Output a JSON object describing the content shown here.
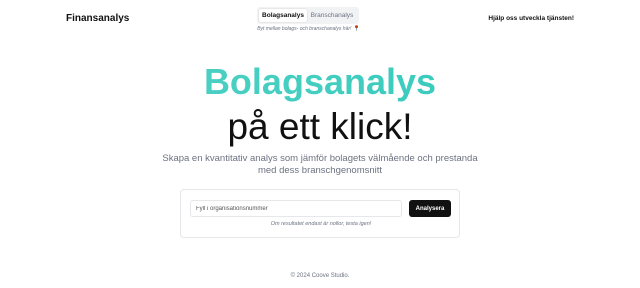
{
  "header": {
    "brand": "Finansanalys",
    "help_link": "Hjälp oss utveckla tjänsten!",
    "toggle": {
      "options": [
        "Bolagsanalys",
        "Branschanalys"
      ],
      "selected": "Bolagsanalys",
      "hint": "Byt mellan bolags- och branschanalys här!",
      "hint_icon": "pin-icon"
    }
  },
  "hero": {
    "title_accent": "Bolagsanalys",
    "title_main": "på ett klick!",
    "subtitle": "Skapa en kvantitativ analys som jämför bolagets välmående och prestanda med dess branschgenomsnitt"
  },
  "form": {
    "input_placeholder": "Fyll i organisationsnummer",
    "input_value": "",
    "button_label": "Analysera",
    "note": "Om resultatet endast är nollor, testa igen!"
  },
  "footer": {
    "copyright": "© 2024 Coove Studio."
  },
  "colors": {
    "accent_start": "#57d3c8",
    "accent_end": "#2ec8b8",
    "button_bg": "#111111"
  }
}
